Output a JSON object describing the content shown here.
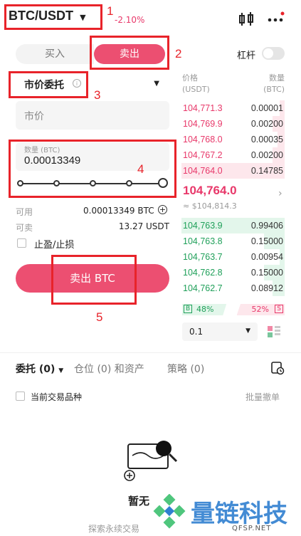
{
  "header": {
    "pair": "BTC/USDT",
    "change": "-2.10%"
  },
  "annotations": [
    "1",
    "2",
    "3",
    "4",
    "5"
  ],
  "side_tabs": {
    "buy": "买入",
    "sell": "卖出"
  },
  "leverage_label": "杠杆",
  "order_type": "市价委托",
  "price_placeholder": "市价",
  "qty": {
    "label": "数量 (BTC)",
    "value": "0.00013349"
  },
  "account": {
    "available_label": "可用",
    "available_value": "0.00013349 BTC",
    "sellable_label": "可卖",
    "sellable_value": "13.27 USDT"
  },
  "tpsl_label": "止盈/止损",
  "submit_label": "卖出 BTC",
  "orderbook": {
    "price_header": "价格",
    "price_unit": "(USDT)",
    "qty_header": "数量",
    "qty_unit": "(BTC)",
    "asks": [
      {
        "price": "104,771.3",
        "qty": "0.00001",
        "depth": 0.05
      },
      {
        "price": "104,769.9",
        "qty": "0.00200",
        "depth": 0.12
      },
      {
        "price": "104,768.0",
        "qty": "0.00035",
        "depth": 0.07
      },
      {
        "price": "104,767.2",
        "qty": "0.00200",
        "depth": 0.12
      },
      {
        "price": "104,764.0",
        "qty": "0.14785",
        "depth": 1.0
      }
    ],
    "last_price": "104,764.0",
    "last_price_usd": "≈ $104,814.3",
    "bids": [
      {
        "price": "104,763.9",
        "qty": "0.99406",
        "depth": 1.0
      },
      {
        "price": "104,763.8",
        "qty": "0.15000",
        "depth": 0.2
      },
      {
        "price": "104,763.7",
        "qty": "0.00954",
        "depth": 0.05
      },
      {
        "price": "104,762.8",
        "qty": "0.15000",
        "depth": 0.2
      },
      {
        "price": "104,762.7",
        "qty": "0.08912",
        "depth": 0.12
      }
    ],
    "buy_ratio_letter": "B",
    "buy_ratio": "48%",
    "buy_ratio_value": 48,
    "sell_ratio": "52%",
    "sell_ratio_letter": "S",
    "precision": "0.1"
  },
  "bottom_tabs": {
    "orders": "委托 (0)",
    "positions": "仓位 (0) 和资产",
    "strategy": "策略 (0)"
  },
  "current_pair_label": "当前交易品种",
  "batch_cancel": "批量撤单",
  "empty_title": "暂无",
  "empty_link": "探索永续交易",
  "watermark": {
    "cn": "量链科技",
    "en": "QFSP.NET"
  },
  "colors": {
    "sell": "#e8386a",
    "buy": "#20a05a",
    "annotation": "#e8232a"
  }
}
